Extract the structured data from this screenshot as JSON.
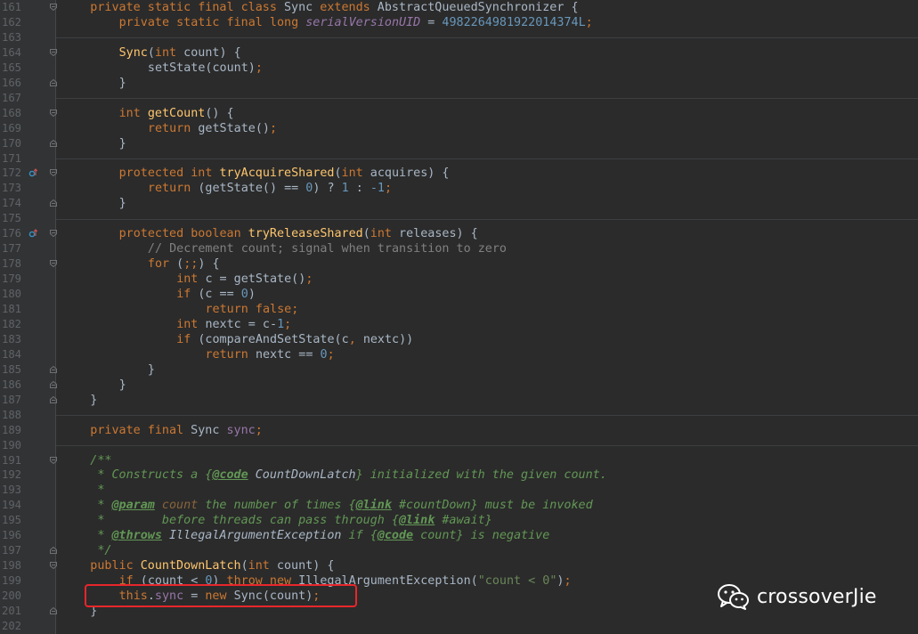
{
  "editor": {
    "lines": [
      {
        "n": "161",
        "fold": "open",
        "tokens": [
          [
            "kw",
            "private static final class "
          ],
          [
            "p",
            "Sync "
          ],
          [
            "kw",
            "extends "
          ],
          [
            "p",
            "AbstractQueuedSynchronizer {"
          ]
        ],
        "indent": 1
      },
      {
        "n": "162",
        "tokens": [
          [
            "kw",
            "private static final long "
          ],
          [
            "field-i",
            "serialVersionUID"
          ],
          [
            "p",
            " = "
          ],
          [
            "num",
            "4982264981922014374L"
          ],
          [
            "kw",
            ";"
          ]
        ],
        "indent": 2
      },
      {
        "n": "163",
        "tokens": [],
        "indent": 0,
        "sep": true
      },
      {
        "n": "164",
        "fold": "open",
        "tokens": [
          [
            "fn",
            "Sync"
          ],
          [
            "p",
            "("
          ],
          [
            "kw",
            "int "
          ],
          [
            "p",
            "count) {"
          ]
        ],
        "indent": 2
      },
      {
        "n": "165",
        "tokens": [
          [
            "p",
            "setState(count)"
          ],
          [
            "kw",
            ";"
          ]
        ],
        "indent": 3
      },
      {
        "n": "166",
        "fold": "close",
        "tokens": [
          [
            "p",
            "}"
          ]
        ],
        "indent": 2
      },
      {
        "n": "167",
        "tokens": [],
        "indent": 0,
        "sep": true
      },
      {
        "n": "168",
        "fold": "open",
        "tokens": [
          [
            "kw",
            "int "
          ],
          [
            "fn",
            "getCount"
          ],
          [
            "p",
            "() {"
          ]
        ],
        "indent": 2
      },
      {
        "n": "169",
        "tokens": [
          [
            "kw",
            "return "
          ],
          [
            "p",
            "getState()"
          ],
          [
            "kw",
            ";"
          ]
        ],
        "indent": 3
      },
      {
        "n": "170",
        "fold": "close",
        "tokens": [
          [
            "p",
            "}"
          ]
        ],
        "indent": 2
      },
      {
        "n": "171",
        "tokens": [],
        "indent": 0,
        "sep": true
      },
      {
        "n": "172",
        "marker": true,
        "fold": "open",
        "tokens": [
          [
            "kw",
            "protected int "
          ],
          [
            "fn",
            "tryAcquireShared"
          ],
          [
            "p",
            "("
          ],
          [
            "kw",
            "int "
          ],
          [
            "p",
            "acquires) {"
          ]
        ],
        "indent": 2
      },
      {
        "n": "173",
        "tokens": [
          [
            "kw",
            "return "
          ],
          [
            "p",
            "(getState() == "
          ],
          [
            "num",
            "0"
          ],
          [
            "p",
            ") ? "
          ],
          [
            "num",
            "1"
          ],
          [
            "p",
            " : "
          ],
          [
            "num",
            "-1"
          ],
          [
            "kw",
            ";"
          ]
        ],
        "indent": 3
      },
      {
        "n": "174",
        "fold": "close",
        "tokens": [
          [
            "p",
            "}"
          ]
        ],
        "indent": 2
      },
      {
        "n": "175",
        "tokens": [],
        "indent": 0,
        "sep": true
      },
      {
        "n": "176",
        "marker": true,
        "fold": "open",
        "tokens": [
          [
            "kw",
            "protected boolean "
          ],
          [
            "fn",
            "tryReleaseShared"
          ],
          [
            "p",
            "("
          ],
          [
            "kw",
            "int "
          ],
          [
            "p",
            "releases) {"
          ]
        ],
        "indent": 2
      },
      {
        "n": "177",
        "tokens": [
          [
            "cmt",
            "// Decrement count; signal when transition to zero"
          ]
        ],
        "indent": 3
      },
      {
        "n": "178",
        "fold": "open",
        "tokens": [
          [
            "kw",
            "for "
          ],
          [
            "p",
            "("
          ],
          [
            "kw",
            ";;"
          ],
          [
            "p",
            ") {"
          ]
        ],
        "indent": 3
      },
      {
        "n": "179",
        "tokens": [
          [
            "kw",
            "int "
          ],
          [
            "p",
            "c = getState()"
          ],
          [
            "kw",
            ";"
          ]
        ],
        "indent": 4
      },
      {
        "n": "180",
        "tokens": [
          [
            "kw",
            "if "
          ],
          [
            "p",
            "(c == "
          ],
          [
            "num",
            "0"
          ],
          [
            "p",
            ")"
          ]
        ],
        "indent": 4
      },
      {
        "n": "181",
        "tokens": [
          [
            "kw",
            "return false;"
          ]
        ],
        "indent": 5
      },
      {
        "n": "182",
        "tokens": [
          [
            "kw",
            "int "
          ],
          [
            "p",
            "nextc = c-"
          ],
          [
            "num",
            "1"
          ],
          [
            "kw",
            ";"
          ]
        ],
        "indent": 4
      },
      {
        "n": "183",
        "tokens": [
          [
            "kw",
            "if "
          ],
          [
            "p",
            "(compareAndSetState(c"
          ],
          [
            "kw",
            ", "
          ],
          [
            "p",
            "nextc))"
          ]
        ],
        "indent": 4
      },
      {
        "n": "184",
        "tokens": [
          [
            "kw",
            "return "
          ],
          [
            "p",
            "nextc == "
          ],
          [
            "num",
            "0"
          ],
          [
            "kw",
            ";"
          ]
        ],
        "indent": 5
      },
      {
        "n": "185",
        "fold": "close",
        "tokens": [
          [
            "p",
            "}"
          ]
        ],
        "indent": 3
      },
      {
        "n": "186",
        "fold": "close",
        "tokens": [
          [
            "p",
            "}"
          ]
        ],
        "indent": 2
      },
      {
        "n": "187",
        "fold": "close",
        "tokens": [
          [
            "p",
            "}"
          ]
        ],
        "indent": 1
      },
      {
        "n": "188",
        "tokens": [],
        "indent": 0,
        "sep": true
      },
      {
        "n": "189",
        "tokens": [
          [
            "kw",
            "private final "
          ],
          [
            "p",
            "Sync "
          ],
          [
            "field",
            "sync"
          ],
          [
            "kw",
            ";"
          ]
        ],
        "indent": 1
      },
      {
        "n": "190",
        "tokens": [],
        "indent": 0,
        "sep": true
      },
      {
        "n": "191",
        "fold": "open",
        "tokens": [
          [
            "doc",
            "/**"
          ]
        ],
        "indent": 1
      },
      {
        "n": "192",
        "tokens": [
          [
            "doc",
            " * Constructs a {"
          ],
          [
            "tag",
            "@code"
          ],
          [
            "docref",
            " CountDownLatch"
          ],
          [
            "doc",
            "} initialized with the given count."
          ]
        ],
        "indent": 1
      },
      {
        "n": "193",
        "tokens": [
          [
            "doc",
            " *"
          ]
        ],
        "indent": 1
      },
      {
        "n": "194",
        "tokens": [
          [
            "doc",
            " * "
          ],
          [
            "tag",
            "@param"
          ],
          [
            "docparam",
            " count"
          ],
          [
            "doc",
            " the number of times {"
          ],
          [
            "tag",
            "@link"
          ],
          [
            "doc",
            " #countDown} must be invoked"
          ]
        ],
        "indent": 1
      },
      {
        "n": "195",
        "tokens": [
          [
            "doc",
            " *        before threads can pass through {"
          ],
          [
            "tag",
            "@link"
          ],
          [
            "doc",
            " #await}"
          ]
        ],
        "indent": 1
      },
      {
        "n": "196",
        "tokens": [
          [
            "doc",
            " * "
          ],
          [
            "tag",
            "@throws"
          ],
          [
            "docref",
            " IllegalArgumentException"
          ],
          [
            "doc",
            " if {"
          ],
          [
            "tag",
            "@code"
          ],
          [
            "doc",
            " count} is negative"
          ]
        ],
        "indent": 1
      },
      {
        "n": "197",
        "fold": "close",
        "tokens": [
          [
            "doc",
            " */"
          ]
        ],
        "indent": 1
      },
      {
        "n": "198",
        "fold": "open",
        "tokens": [
          [
            "kw",
            "public "
          ],
          [
            "fn",
            "CountDownLatch"
          ],
          [
            "p",
            "("
          ],
          [
            "kw",
            "int "
          ],
          [
            "p",
            "count) {"
          ]
        ],
        "indent": 1
      },
      {
        "n": "199",
        "tokens": [
          [
            "kw",
            "if "
          ],
          [
            "p",
            "(count < "
          ],
          [
            "num",
            "0"
          ],
          [
            "p",
            ") "
          ],
          [
            "kw",
            "throw new "
          ],
          [
            "p",
            "IllegalArgumentException("
          ],
          [
            "str",
            "\"count < 0\""
          ],
          [
            "p",
            ")"
          ],
          [
            "kw",
            ";"
          ]
        ],
        "indent": 2
      },
      {
        "n": "200",
        "tokens": [
          [
            "kw",
            "this"
          ],
          [
            "p",
            "."
          ],
          [
            "field",
            "sync"
          ],
          [
            "p",
            " = "
          ],
          [
            "kw",
            "new "
          ],
          [
            "p",
            "Sync(count)"
          ],
          [
            "kw",
            ";"
          ]
        ],
        "indent": 2
      },
      {
        "n": "201",
        "fold": "close",
        "tokens": [
          [
            "p",
            "}"
          ]
        ],
        "indent": 1
      },
      {
        "n": "202",
        "tokens": [],
        "indent": 0
      }
    ]
  },
  "watermark": {
    "text": "crossoverJie",
    "icon": "wechat-icon"
  },
  "colors": {
    "background": "#2b2b2b",
    "gutter": "#313335",
    "keyword": "#cc7832",
    "function": "#ffc66d",
    "number": "#6897bb",
    "comment": "#808080",
    "javadoc": "#629755",
    "field": "#9876aa",
    "string": "#6a8759",
    "highlight": "#e8262b"
  }
}
